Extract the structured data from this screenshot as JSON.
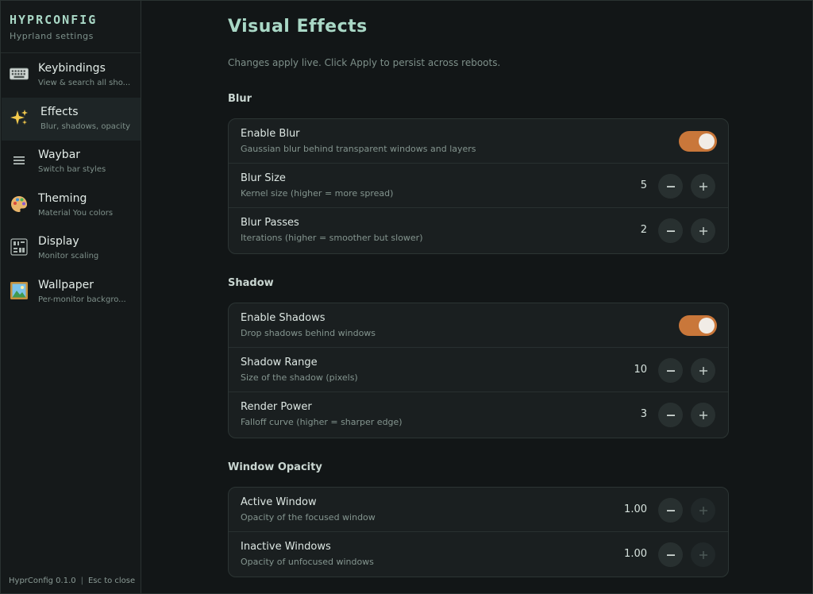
{
  "app": {
    "title": "HYPRCONFIG",
    "subtitle": "Hyprland settings"
  },
  "sidebar": {
    "items": [
      {
        "label": "Keybindings",
        "desc": "View & search all sho...",
        "icon": "keyboard-icon",
        "glyph": "⌨",
        "active": false
      },
      {
        "label": "Effects",
        "desc": "Blur, shadows, opacity",
        "icon": "sparkles-icon",
        "glyph": "✨",
        "active": true
      },
      {
        "label": "Waybar",
        "desc": "Switch bar styles",
        "icon": "menu-icon",
        "glyph": "≡",
        "active": false
      },
      {
        "label": "Theming",
        "desc": "Material You colors",
        "icon": "palette-icon",
        "glyph": "🎨",
        "active": false
      },
      {
        "label": "Display",
        "desc": "Monitor scaling",
        "icon": "display-icon",
        "glyph": "▦",
        "active": false
      },
      {
        "label": "Wallpaper",
        "desc": "Per-monitor backgro...",
        "icon": "picture-icon",
        "glyph": "🖼",
        "active": false
      }
    ],
    "footer": {
      "version": "HyprConfig 0.1.0",
      "separator": "|",
      "hint": "Esc to close"
    }
  },
  "main": {
    "title": "Visual Effects",
    "subtitle": "Changes apply live. Click Apply to persist across reboots.",
    "sections": {
      "blur": {
        "title": "Blur",
        "rows": [
          {
            "label": "Enable Blur",
            "desc": "Gaussian blur behind transparent windows and layers",
            "type": "toggle",
            "on": true
          },
          {
            "label": "Blur Size",
            "desc": "Kernel size (higher = more spread)",
            "type": "stepper",
            "value": "5"
          },
          {
            "label": "Blur Passes",
            "desc": "Iterations (higher = smoother but slower)",
            "type": "stepper",
            "value": "2"
          }
        ]
      },
      "shadow": {
        "title": "Shadow",
        "rows": [
          {
            "label": "Enable Shadows",
            "desc": "Drop shadows behind windows",
            "type": "toggle",
            "on": true
          },
          {
            "label": "Shadow Range",
            "desc": "Size of the shadow (pixels)",
            "type": "stepper",
            "value": "10"
          },
          {
            "label": "Render Power",
            "desc": "Falloff curve (higher = sharper edge)",
            "type": "stepper",
            "value": "3"
          }
        ]
      },
      "opacity": {
        "title": "Window Opacity",
        "rows": [
          {
            "label": "Active Window",
            "desc": "Opacity of the focused window",
            "type": "stepper",
            "value": "1.00",
            "plus_disabled": true
          },
          {
            "label": "Inactive Windows",
            "desc": "Opacity of unfocused windows",
            "type": "stepper",
            "value": "1.00",
            "plus_disabled": true
          }
        ]
      }
    }
  },
  "colors": {
    "accent": "#a9d8c6",
    "toggle_on": "#c9773a",
    "background": "#121617",
    "card": "#1a1f20"
  }
}
